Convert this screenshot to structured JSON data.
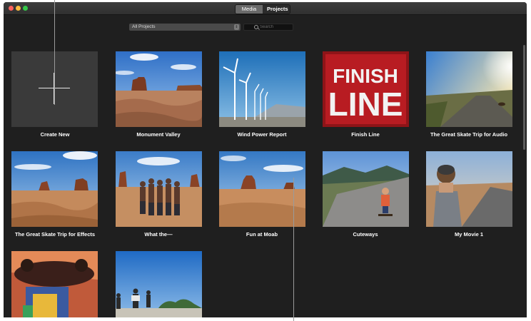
{
  "toolbar": {
    "tabs": [
      {
        "label": "Media",
        "selected": false
      },
      {
        "label": "Projects",
        "selected": true
      }
    ],
    "filter": {
      "selected": "All Projects"
    },
    "search": {
      "placeholder": "Search"
    }
  },
  "projects": {
    "create_new": {
      "label": "Create New"
    },
    "items": [
      {
        "label": "Monument Valley"
      },
      {
        "label": "Wind Power Report"
      },
      {
        "label": "Finish Line",
        "thumbnail_text": [
          "FINISH",
          "LINE"
        ]
      },
      {
        "label": "The Great Skate Trip for Audio"
      },
      {
        "label": "The Great Skate Trip for Effects"
      },
      {
        "label": "What the—"
      },
      {
        "label": "Fun at Moab"
      },
      {
        "label": "Cuteways"
      },
      {
        "label": "My Movie 1"
      },
      {
        "label": ""
      },
      {
        "label": ""
      }
    ]
  },
  "colors": {
    "window_bg": "#1f1f1f",
    "tile_placeholder": "#3a3a3a",
    "finish_red": "#b81c22"
  }
}
